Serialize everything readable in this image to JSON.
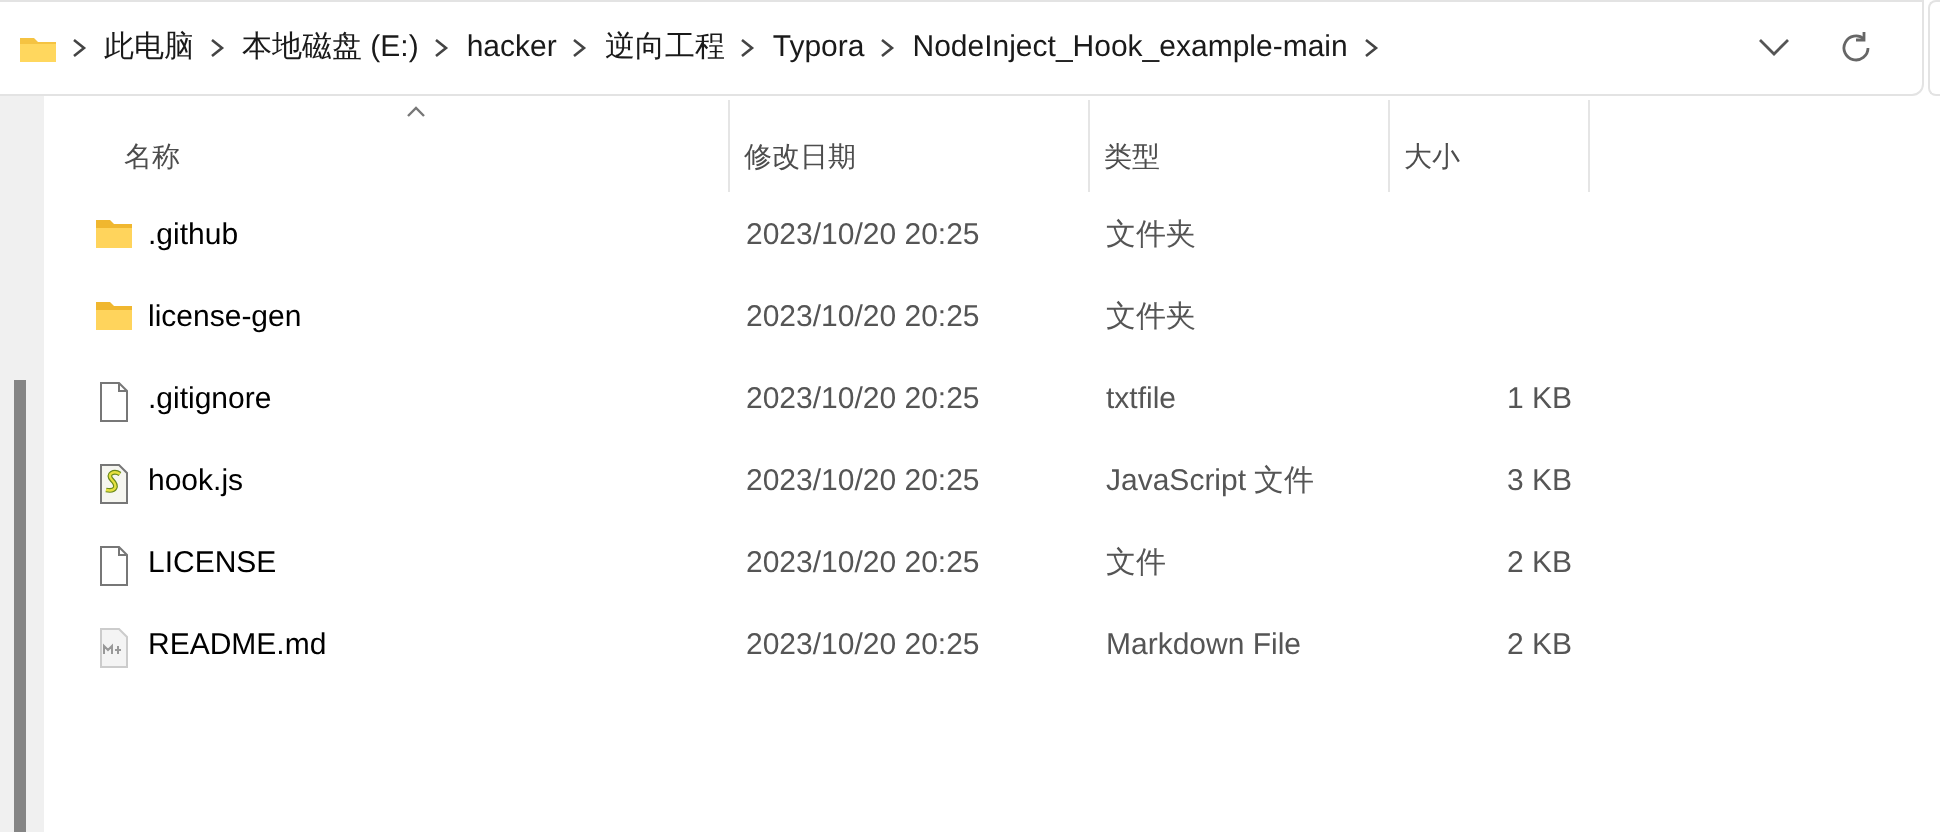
{
  "address_bar": {
    "path": [
      "此电脑",
      "本地磁盘 (E:)",
      "hacker",
      "逆向工程",
      "Typora",
      "NodeInject_Hook_example-main"
    ]
  },
  "columns": [
    {
      "label": "名称",
      "sorted": true
    },
    {
      "label": "修改日期",
      "sorted": false
    },
    {
      "label": "类型",
      "sorted": false
    },
    {
      "label": "大小",
      "sorted": false
    }
  ],
  "files": [
    {
      "kind": "folder",
      "name": ".github",
      "modified": "2023/10/20 20:25",
      "type": "文件夹"
    },
    {
      "kind": "folder",
      "name": "license-gen",
      "modified": "2023/10/20 20:25",
      "type": "文件夹"
    },
    {
      "kind": "file",
      "name": ".gitignore",
      "modified": "2023/10/20 20:25",
      "type": "txtfile",
      "size": "1 KB"
    },
    {
      "kind": "script",
      "name": "hook.js",
      "modified": "2023/10/20 20:25",
      "type": "JavaScript 文件",
      "size": "3 KB"
    },
    {
      "kind": "file",
      "name": "LICENSE",
      "modified": "2023/10/20 20:25",
      "type": "文件",
      "size": "2 KB"
    },
    {
      "kind": "markdown",
      "name": "README.md",
      "modified": "2023/10/20 20:25",
      "type": "Markdown File",
      "size": "2 KB"
    }
  ]
}
